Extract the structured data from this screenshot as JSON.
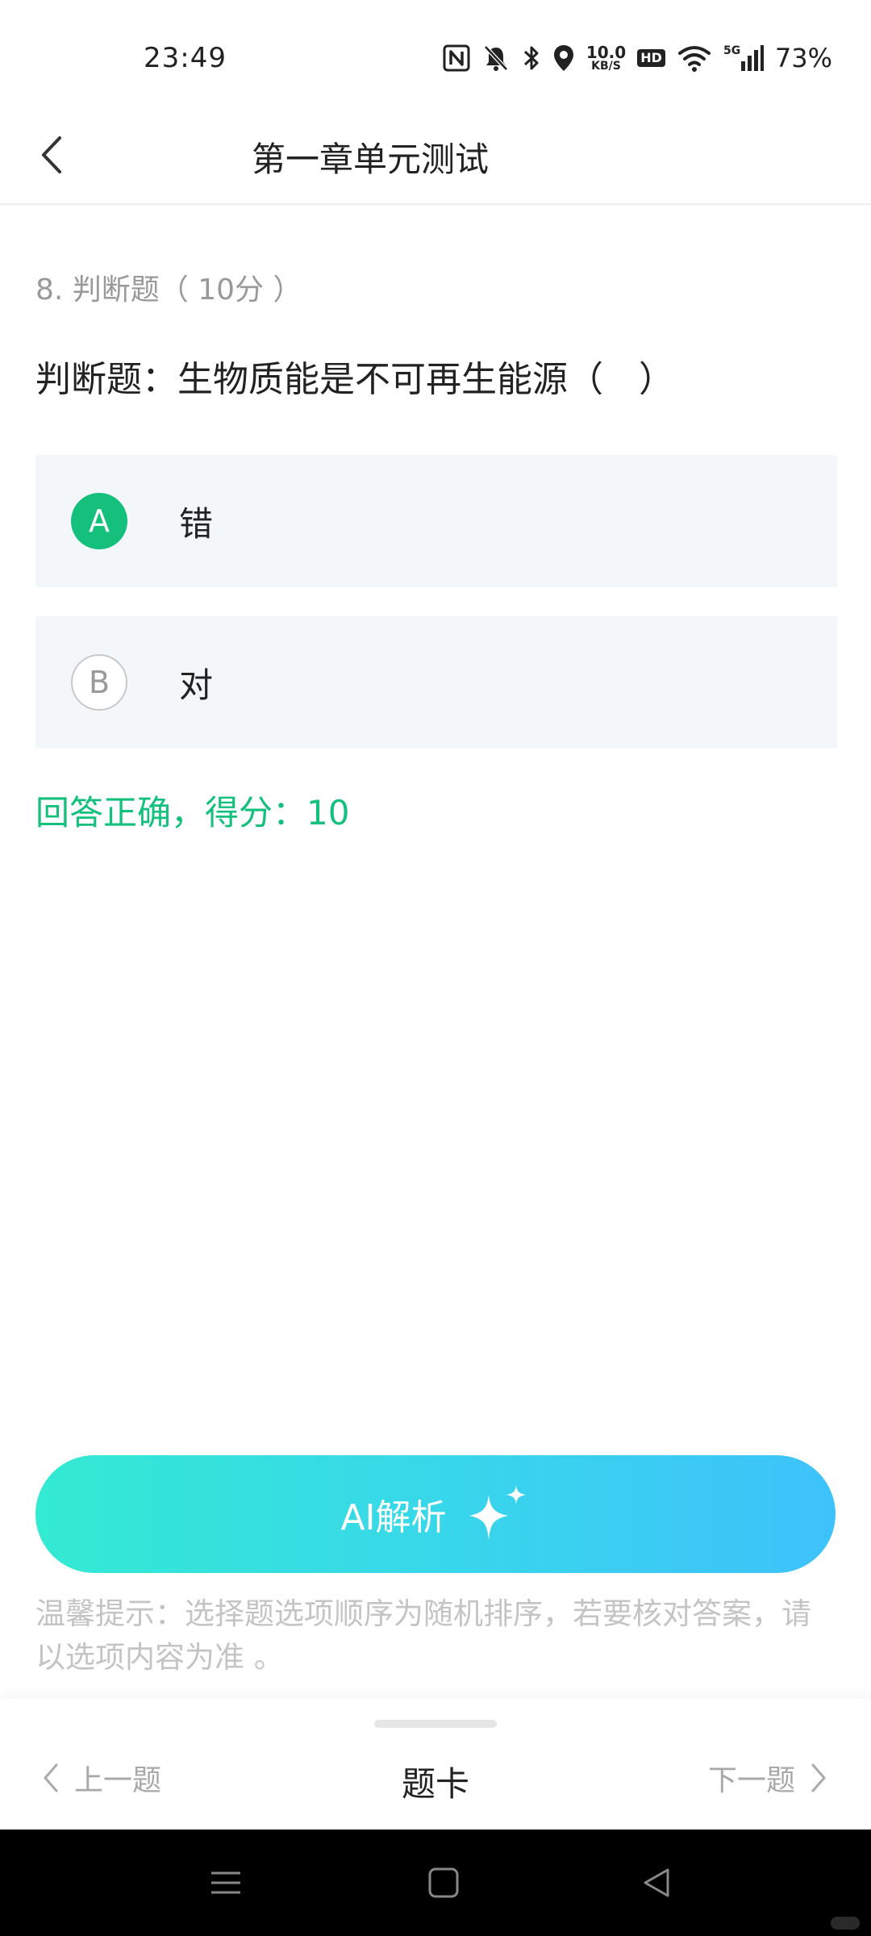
{
  "status_bar": {
    "time": "23:49",
    "net_speed_value": "10.0",
    "net_speed_unit": "KB/S",
    "hd_label": "HD",
    "network_label": "5G",
    "battery": "73%",
    "icons": [
      "nfc-icon",
      "bell-muted-icon",
      "bluetooth-icon",
      "location-icon",
      "wifi-icon",
      "signal-icon"
    ]
  },
  "header": {
    "title": "第一章单元测试",
    "back_icon": "chevron-left-icon"
  },
  "question": {
    "meta": "8. 判断题（ 10分 ）",
    "text": "判断题：生物质能是不可再生能源（　）",
    "options": [
      {
        "letter": "A",
        "text": "错",
        "selected": true
      },
      {
        "letter": "B",
        "text": "对",
        "selected": false
      }
    ],
    "result": "回答正确，得分：10"
  },
  "ai_button": {
    "label": "AI解析",
    "icon": "sparkle-icon"
  },
  "tip": "温馨提示：选择题选项顺序为随机排序，若要核对答案，请以选项内容为准 。",
  "bottom_bar": {
    "prev_label": "上一题",
    "card_label": "题卡",
    "next_label": "下一题"
  },
  "colors": {
    "accent_green": "#15c07d",
    "gradient_start": "#33ead2",
    "gradient_end": "#3ec2fb",
    "option_bg": "#f4f7f9"
  }
}
